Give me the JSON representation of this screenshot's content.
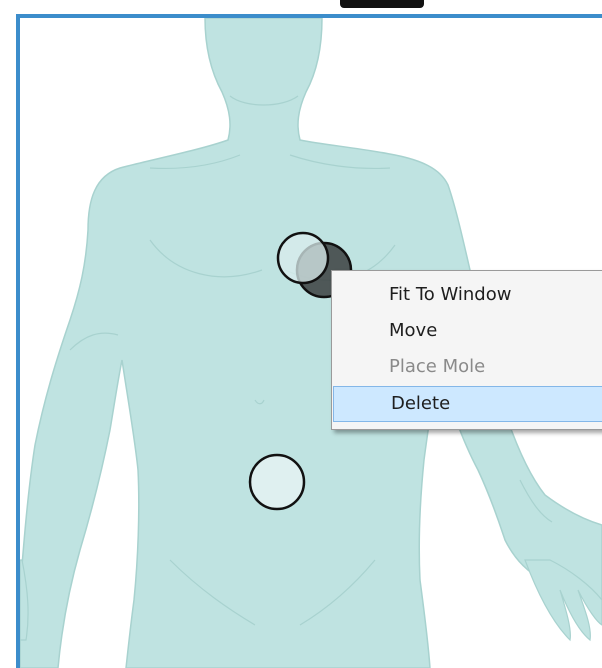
{
  "canvas": {
    "body_color": "#bfe3e1",
    "body_outline_color": "#9fcbc8",
    "frame_color": "#3c8dcb"
  },
  "moles": [
    {
      "name": "mole-chest-selected",
      "fill": "#d9ecec",
      "fill_opacity": 0.75
    },
    {
      "name": "mole-chest-dark",
      "fill": "#3b3f3f",
      "fill_opacity": 0.85
    },
    {
      "name": "mole-abdomen",
      "fill": "#dff0f0",
      "fill_opacity": 1
    }
  ],
  "context_menu": {
    "items": [
      {
        "label": "Fit To Window",
        "state": "normal"
      },
      {
        "label": "Move",
        "state": "normal"
      },
      {
        "label": "Place Mole",
        "state": "disabled"
      },
      {
        "label": "Delete",
        "state": "highlighted"
      }
    ]
  }
}
